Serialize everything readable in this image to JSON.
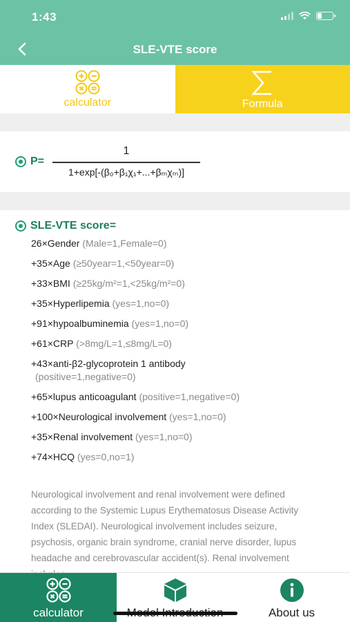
{
  "status": {
    "time": "1:43"
  },
  "nav": {
    "title": "SLE-VTE score"
  },
  "top_tabs": [
    {
      "label": "calculator"
    },
    {
      "label": "Formula"
    }
  ],
  "formula": {
    "label": "P=",
    "numerator": "1",
    "denominator": "1+exp[-(β₀+β₁χ₁+...+βₘχₘ)]"
  },
  "score": {
    "title": "SLE-VTE score=",
    "items": [
      {
        "term": "26×Gender",
        "cond": "(Male=1,Female=0)"
      },
      {
        "term": "+35×Age",
        "cond": "(≥50year=1,<50year=0)"
      },
      {
        "term": "+33×BMI",
        "cond": "(≥25kg/m²=1,<25kg/m²=0)"
      },
      {
        "term": "+35×Hyperlipemia",
        "cond": "(yes=1,no=0)"
      },
      {
        "term": "+91×hypoalbuminemia",
        "cond": "(yes=1,no=0)"
      },
      {
        "term": "+61×CRP",
        "cond": "(>8mg/L=1,≤8mg/L=0)"
      },
      {
        "term": "+43×anti-β2-glycoprotein 1 antibody",
        "cond": "(positive=1,negative=0)"
      },
      {
        "term": "+65×lupus anticoagulant",
        "cond": "(positive=1,negative=0)"
      },
      {
        "term": "+100×Neurological involvement",
        "cond": "(yes=1,no=0)"
      },
      {
        "term": "+35×Renal involvement",
        "cond": "(yes=1,no=0)"
      },
      {
        "term": "+74×HCQ",
        "cond": "(yes=0,no=1)"
      }
    ],
    "note": "Neurological involvement and renal involvement were defined according to the Systemic Lupus Erythematosus Disease Activity Index (SLEDAI). Neurological involvement includes seizure, psychosis, organic brain syndrome, cranial nerve disorder, lupus headache and cerebrovascular accident(s). Renal involvement includes"
  },
  "bottom_tabs": [
    {
      "label": "calculator",
      "icon": "calculator-icon"
    },
    {
      "label": "Model Introduction",
      "icon": "cube-icon"
    },
    {
      "label": "About us",
      "icon": "info-icon"
    }
  ],
  "colors": {
    "header": "#6cc2a4",
    "formula_tab": "#f7d21c",
    "accent_green": "#1e7f5b",
    "active_bottom_tab": "#1c8563"
  }
}
